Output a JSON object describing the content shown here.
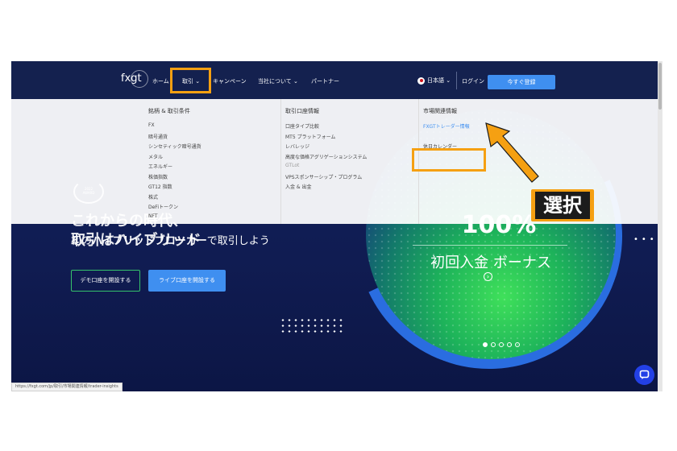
{
  "nav": {
    "logo": "fxgt",
    "items": [
      {
        "label": "ホーム"
      },
      {
        "label": "取引 ⌄"
      },
      {
        "label": "キャンペーン"
      },
      {
        "label": "当社について ⌄"
      },
      {
        "label": "パートナー"
      }
    ],
    "language": "日本語 ⌄",
    "login": "ログイン",
    "register": "今すぐ登録"
  },
  "dropdown": {
    "columns": [
      {
        "title": "銘柄 & 取引条件",
        "items": [
          "FX",
          "暗号通貨",
          "シンセティック暗号通貨",
          "メタル",
          "エネルギー",
          "株価指数",
          "GT12 指数",
          "株式",
          "DeFiトークン",
          "NFT"
        ]
      },
      {
        "title": "取引口座情報",
        "items": [
          "口座タイプ比較",
          "MT5 プラットフォーム",
          "レバレッジ",
          "高度な価格アグリゲーションシステム",
          "GTLot",
          "VPSスポンサーシップ・プログラム",
          "入金 & 出金"
        ]
      },
      {
        "title": "市場関連情報",
        "items": [
          "FXGTトレーダー情報",
          "",
          "休日カレンダー"
        ]
      }
    ]
  },
  "hero": {
    "headline_line1": "これからの時代、",
    "headline_line2": "取引はハイブリッド",
    "badge_text": "2022 AWARD",
    "tagline_pre": "初の",
    "tagline_bold": "ハイブリッドブローカー",
    "tagline_post": "で取引しよう",
    "demo_button": "デモ口座を開設する",
    "live_button": "ライブ口座を開設する"
  },
  "promo": {
    "percent": "100%",
    "title": "初回入金 ボーナス"
  },
  "status_url": "https://fxgt.com/jp/取引/市場関連情報/trader-insights",
  "annotation": {
    "label": "選択",
    "color": "#f5a012"
  },
  "colors": {
    "nav_bg": "#14214f",
    "accent_blue": "#3f8ff0",
    "highlight_orange": "#f5a012",
    "demo_border": "#35c26b"
  }
}
